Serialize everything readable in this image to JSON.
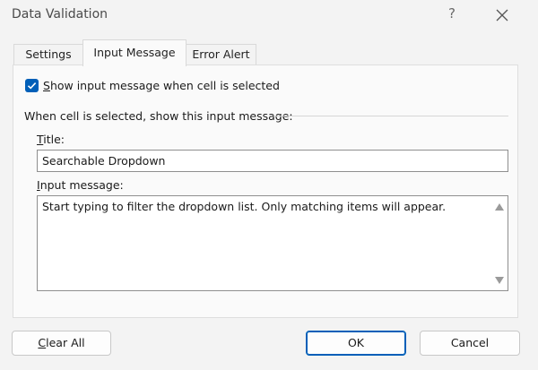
{
  "dialog": {
    "title": "Data Validation",
    "help_glyph": "?"
  },
  "tabs": [
    {
      "label": "Settings",
      "active": false
    },
    {
      "label": "Input Message",
      "active": true
    },
    {
      "label": "Error Alert",
      "active": false
    }
  ],
  "input_message": {
    "show_checkbox": {
      "checked": true,
      "mnemonic": "S",
      "label_rest": "how input message when cell is selected"
    },
    "section_label": "When cell is selected, show this input message:",
    "title_label": {
      "mnemonic": "T",
      "rest": "itle:"
    },
    "title_value": "Searchable Dropdown",
    "message_label": {
      "mnemonic": "I",
      "rest": "nput message:"
    },
    "message_value": "Start typing to filter the dropdown list. Only matching items will appear."
  },
  "footer": {
    "clear_all": {
      "mnemonic": "C",
      "rest": "lear All"
    },
    "ok_label": "OK",
    "cancel_label": "Cancel"
  },
  "colors": {
    "accent": "#005fb8",
    "background": "#f3f3f3",
    "panel": "#fafafa"
  }
}
